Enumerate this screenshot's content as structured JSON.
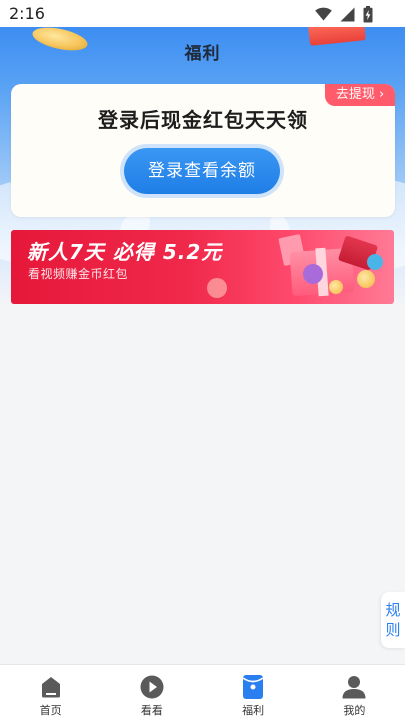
{
  "status_bar": {
    "time": "2:16"
  },
  "header": {
    "title": "福利"
  },
  "login_card": {
    "withdraw_label": "去提现",
    "withdraw_chevron": "›",
    "headline": "登录后现金红包天天领",
    "login_button": "登录查看余额"
  },
  "promo_banner": {
    "title": "新人7天 必得 5.2元",
    "subtitle": "看视频赚金币红包"
  },
  "rules_tab": {
    "chars": [
      "规",
      "则"
    ]
  },
  "bottom_nav": {
    "items": [
      {
        "label": "首页",
        "icon": "home-icon",
        "active": false
      },
      {
        "label": "看看",
        "icon": "play-icon",
        "active": false
      },
      {
        "label": "福利",
        "icon": "welfare-icon",
        "active": true
      },
      {
        "label": "我的",
        "icon": "profile-icon",
        "active": false
      }
    ]
  },
  "colors": {
    "accent_blue": "#2a7ff0",
    "login_button": "#1f7ee6",
    "withdraw_tag": "#ff5b6b",
    "promo_red": "#f0284a",
    "nav_inactive": "#5a5a5a"
  }
}
